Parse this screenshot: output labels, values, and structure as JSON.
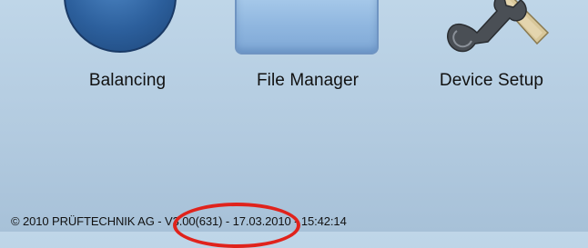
{
  "apps": [
    {
      "id": "balancing",
      "label": "Balancing",
      "icon": "balancing-disk-icon"
    },
    {
      "id": "file-manager",
      "label": "File Manager",
      "icon": "folder-icon"
    },
    {
      "id": "device-setup",
      "label": "Device Setup",
      "icon": "wrench-screwdriver-icon"
    }
  ],
  "footer": {
    "text": "© 2010 PRÜFTECHNIK AG - V3.00(631) - 17.03.2010 - 15:42:14"
  },
  "colors": {
    "background": "#b3cbe0",
    "highlight": "#e0231c"
  }
}
